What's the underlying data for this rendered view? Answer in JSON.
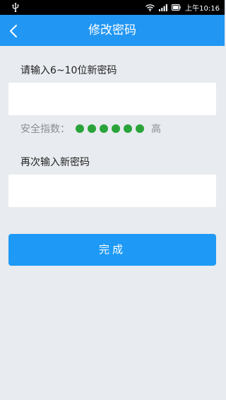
{
  "status_bar": {
    "icons": [
      "usb-icon",
      "wifi-icon",
      "signal-icon",
      "battery-icon"
    ],
    "time": "上午10:16"
  },
  "header": {
    "title": "修改密码",
    "back_icon": "chevron-left-icon",
    "bg_color": "#2196f3"
  },
  "form": {
    "new_password_label": "请输入6~10位新密码",
    "new_password_value": "",
    "strength_label": "安全指数：",
    "strength_dots": 6,
    "strength_color": "#2aa43a",
    "strength_level": "高",
    "confirm_password_label": "再次输入新密码",
    "confirm_password_value": ""
  },
  "actions": {
    "done_label": "完成",
    "done_color": "#1e9af6"
  }
}
